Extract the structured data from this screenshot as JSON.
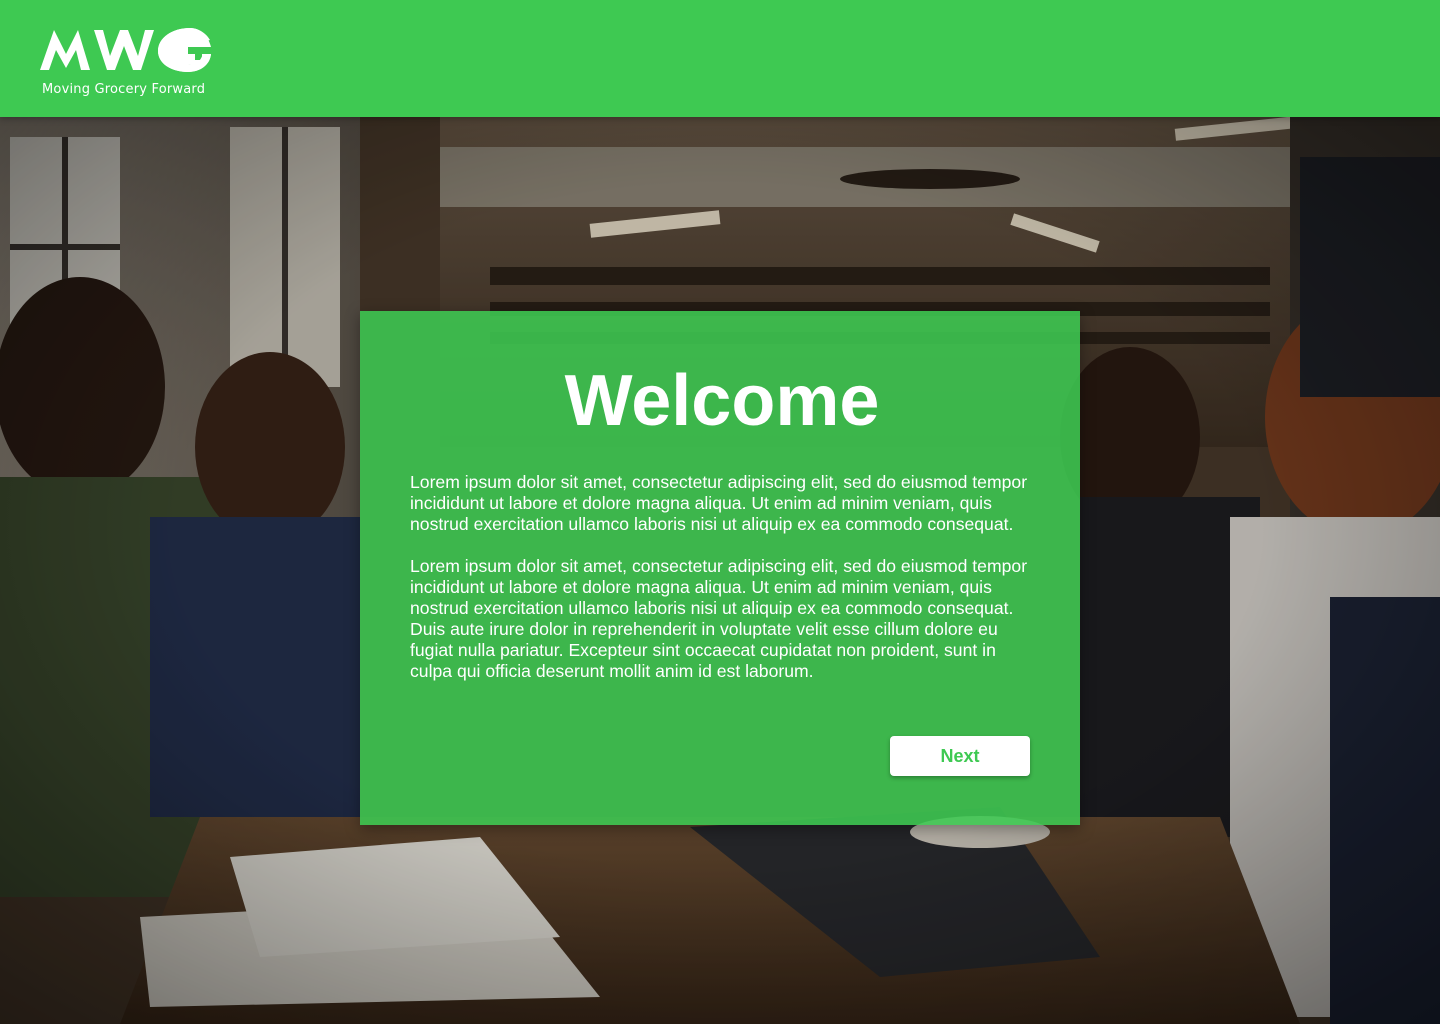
{
  "header": {
    "logo_text": "MWG",
    "tagline": "Moving Grocery Forward",
    "background_color": "#3ec952"
  },
  "background": {
    "description_icon": "cafe-photo"
  },
  "card": {
    "title": "Welcome",
    "paragraphs": [
      "Lorem ipsum dolor sit amet, consectetur adipiscing elit, sed do eiusmod tempor incididunt ut labore et dolore magna aliqua. Ut enim ad minim veniam, quis nostrud exercitation ullamco laboris nisi ut aliquip ex ea commodo consequat.",
      "Lorem ipsum dolor sit amet, consectetur adipiscing elit, sed do eiusmod tempor incididunt ut labore et dolore magna aliqua. Ut enim ad minim veniam, quis nostrud exercitation ullamco laboris nisi ut aliquip ex ea commodo consequat. Duis aute irure dolor in reprehenderit in voluptate velit esse cillum dolore eu fugiat nulla pariatur. Excepteur sint occaecat cupidatat non proident, sunt in culpa qui officia deserunt mollit anim id est laborum."
    ],
    "next_label": "Next",
    "accent_color": "#3ec952"
  }
}
